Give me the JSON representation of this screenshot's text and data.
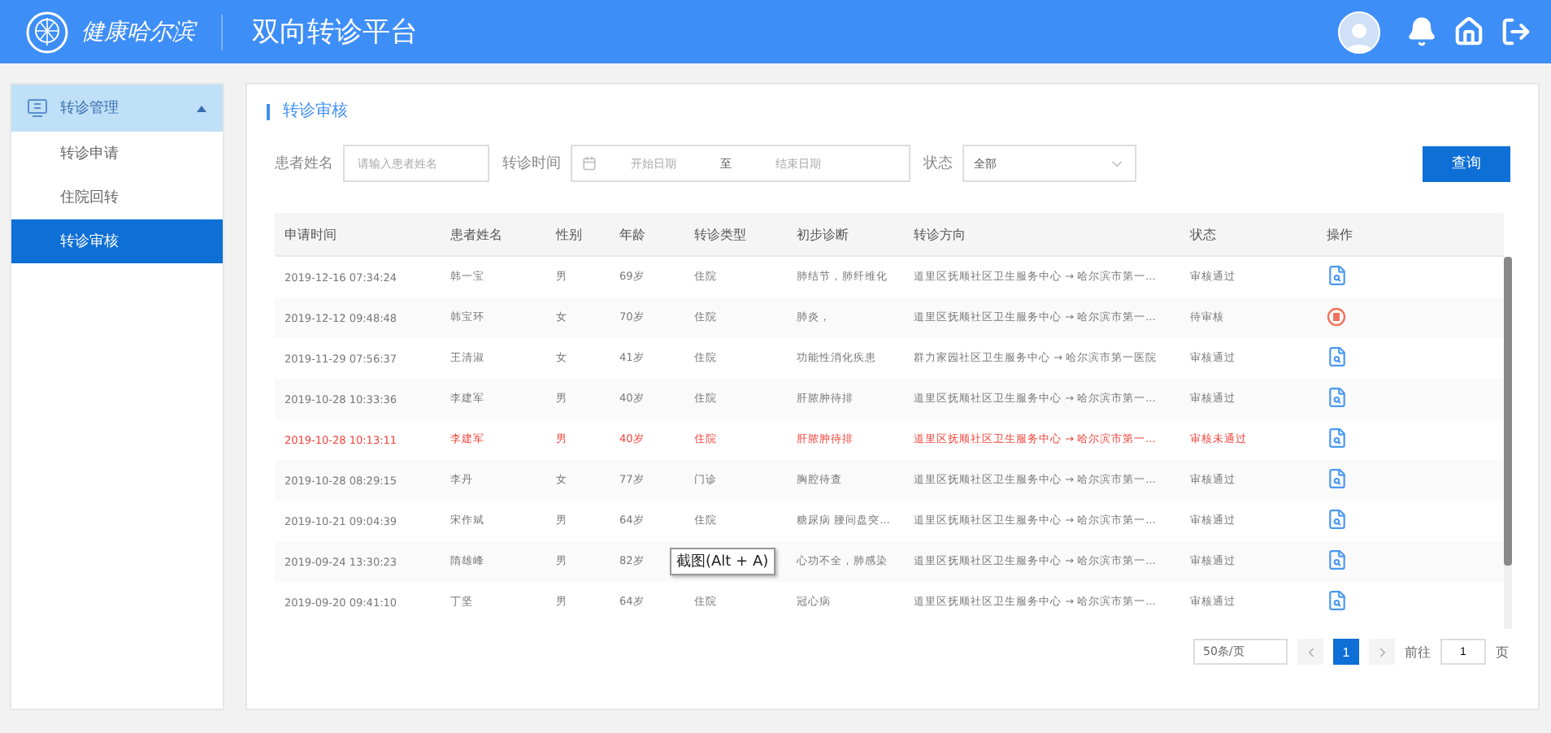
{
  "header": {
    "brand": "健康哈尔滨",
    "title": "双向转诊平台"
  },
  "sidebar": {
    "group": {
      "label": "转诊管理",
      "expanded": true
    },
    "items": [
      {
        "label": "转诊申请",
        "selected": false
      },
      {
        "label": "住院回转",
        "selected": false
      },
      {
        "label": "转诊审核",
        "selected": true
      }
    ]
  },
  "panel_title": "转诊审核",
  "filters": {
    "name_label": "患者姓名",
    "name_placeholder": "请输入患者姓名",
    "time_label": "转诊时间",
    "start_placeholder": "开始日期",
    "range_separator": "至",
    "end_placeholder": "结束日期",
    "status_label": "状态",
    "status_value": "全部",
    "query_button": "查询"
  },
  "table": {
    "columns": [
      "申请时间",
      "患者姓名",
      "性别",
      "年龄",
      "转诊类型",
      "初步诊断",
      "转诊方向",
      "状态",
      "操作"
    ],
    "rows": [
      {
        "kind": "approved",
        "cells": [
          "2019-12-16 07:34:24",
          "韩一宝",
          "男",
          "69岁",
          "住院",
          "肺结节，肺纤维化",
          "道里区抚顺社区卫生服务中心 → 哈尔滨市第一...",
          "审核通过"
        ]
      },
      {
        "kind": "pending",
        "cells": [
          "2019-12-12 09:48:48",
          "韩宝环",
          "女",
          "70岁",
          "住院",
          "肺炎，",
          "道里区抚顺社区卫生服务中心 → 哈尔滨市第一...",
          "待审核"
        ]
      },
      {
        "kind": "approved",
        "cells": [
          "2019-11-29 07:56:37",
          "王清淑",
          "女",
          "41岁",
          "住院",
          "功能性消化疾患",
          "群力家园社区卫生服务中心 → 哈尔滨市第一医院",
          "审核通过"
        ]
      },
      {
        "kind": "approved",
        "cells": [
          "2019-10-28 10:33:36",
          "李建军",
          "男",
          "40岁",
          "住院",
          "肝脓肿待排",
          "道里区抚顺社区卫生服务中心 → 哈尔滨市第一...",
          "审核通过"
        ]
      },
      {
        "kind": "rejected",
        "cells": [
          "2019-10-28 10:13:11",
          "李建军",
          "男",
          "40岁",
          "住院",
          "肝脓肿待排",
          "道里区抚顺社区卫生服务中心 → 哈尔滨市第一...",
          "审核未通过"
        ]
      },
      {
        "kind": "approved",
        "cells": [
          "2019-10-28 08:29:15",
          "李丹",
          "女",
          "77岁",
          "门诊",
          "胸腔待查",
          "道里区抚顺社区卫生服务中心 → 哈尔滨市第一...",
          "审核通过"
        ]
      },
      {
        "kind": "approved",
        "cells": [
          "2019-10-21 09:04:39",
          "宋作斌",
          "男",
          "64岁",
          "住院",
          "糖尿病 腰间盘突...",
          "道里区抚顺社区卫生服务中心 → 哈尔滨市第一...",
          "审核通过"
        ]
      },
      {
        "kind": "approved",
        "tooltip": "截图(Alt + A)",
        "cells": [
          "2019-09-24 13:30:23",
          "隋雄峰",
          "男",
          "82岁",
          null,
          "心功不全，肺感染",
          "道里区抚顺社区卫生服务中心 → 哈尔滨市第一...",
          "审核通过"
        ]
      },
      {
        "kind": "approved",
        "cells": [
          "2019-09-20 09:41:10",
          "丁坚",
          "男",
          "64岁",
          "住院",
          "冠心病",
          "道里区抚顺社区卫生服务中心 → 哈尔滨市第一...",
          "审核通过"
        ]
      }
    ]
  },
  "pagination": {
    "page_size": "50条/页",
    "pages": [
      {
        "label": "1",
        "selected": true
      }
    ],
    "goto_label": "前往",
    "goto_value": "1",
    "page_suffix": "页"
  }
}
